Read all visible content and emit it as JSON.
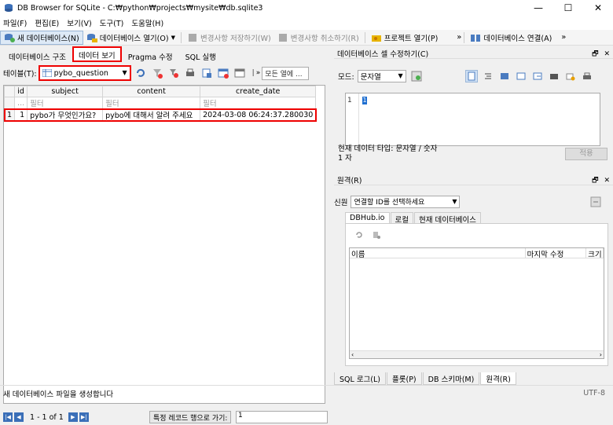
{
  "window": {
    "title": "DB Browser for SQLite - C:₩python₩projects₩mysite₩db.sqlite3",
    "minimize": "—",
    "maximize": "☐",
    "close": "✕"
  },
  "menu": [
    "파일(F)",
    "편집(E)",
    "보기(V)",
    "도구(T)",
    "도움말(H)"
  ],
  "toolbar": {
    "new_db": "새 데이터베이스(N)",
    "open_db": "데이터베이스 열기(O)",
    "write_changes": "변경사항 저장하기(W)",
    "revert_changes": "변경사항 취소하기(R)",
    "open_project": "프로젝트 열기(P)",
    "overflow": "»",
    "attach_db": "데이터베이스 연결(A)",
    "overflow2": "»"
  },
  "main_tabs": [
    "데이터베이스 구조",
    "데이터 보기",
    "Pragma 수정",
    "SQL 실행"
  ],
  "browse": {
    "table_label": "테이블(T):",
    "table_value": "pybo_question",
    "filter_all_placeholder": "모든 열에 ...",
    "filter_overflow": "»",
    "columns": [
      "id",
      "subject",
      "content",
      "create_date"
    ],
    "filter_placeholder": "필터",
    "filter_id_placeholder": "...",
    "rows": [
      {
        "rownum": "1",
        "id": "1",
        "subject": "pybo가 무엇인가요?",
        "content": "pybo에 대해서 알려 주세요",
        "create_date": "2024-03-08 06:24:37.280030"
      }
    ],
    "pager_text": "1 - 1 of 1",
    "goto_label": "특정 레코드 행으로 가기:",
    "goto_value": "1"
  },
  "cell_editor": {
    "title": "데이터베이스 셀 수정하기(C)",
    "mode_label": "모드:",
    "mode_value": "문자열",
    "line_number": "1",
    "cursor_value": "1",
    "type_info": "현재 데이터 타입: 문자열 / 숫자",
    "size_info": "1 자",
    "apply": "적용"
  },
  "remote": {
    "title": "원격(R)",
    "identity_label": "신원",
    "identity_value": "연결할 ID를 선택하세요",
    "tabs": [
      "DBHub.io",
      "로컬",
      "현재 데이터베이스"
    ],
    "columns": [
      "이름",
      "마지막 수정",
      "크기"
    ]
  },
  "dock_tabs": [
    "SQL 로그(L)",
    "플롯(P)",
    "DB 스키마(M)",
    "원격(R)"
  ],
  "dock_btns": {
    "float": "🗗",
    "close": "✕"
  },
  "status": {
    "message": "새 데이터베이스 파일을 생성합니다",
    "encoding": "UTF-8"
  }
}
